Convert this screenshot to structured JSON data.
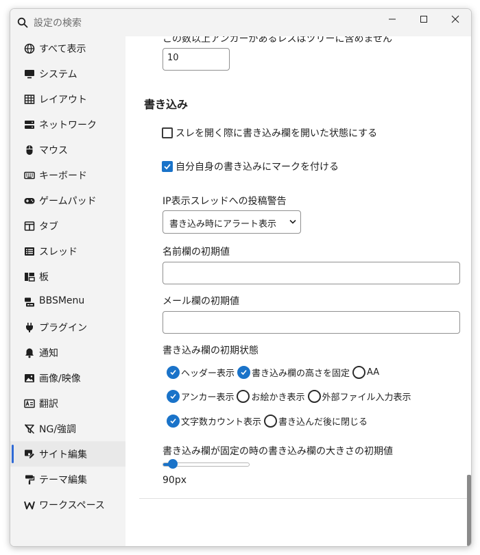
{
  "search": {
    "placeholder": "設定の検索"
  },
  "window_controls": {
    "minimize": "minimize",
    "maximize": "maximize",
    "close": "close"
  },
  "sidebar": {
    "items": [
      {
        "label": "すべて表示",
        "icon": "globe-icon"
      },
      {
        "label": "システム",
        "icon": "monitor-icon"
      },
      {
        "label": "レイアウト",
        "icon": "grid-icon"
      },
      {
        "label": "ネットワーク",
        "icon": "server-icon"
      },
      {
        "label": "マウス",
        "icon": "mouse-icon"
      },
      {
        "label": "キーボード",
        "icon": "keyboard-icon"
      },
      {
        "label": "ゲームパッド",
        "icon": "gamepad-icon"
      },
      {
        "label": "タブ",
        "icon": "tab-icon"
      },
      {
        "label": "スレッド",
        "icon": "list-icon"
      },
      {
        "label": "板",
        "icon": "board-icon"
      },
      {
        "label": "BBSMenu",
        "icon": "bbsmenu-icon"
      },
      {
        "label": "プラグイン",
        "icon": "plug-icon"
      },
      {
        "label": "通知",
        "icon": "bell-icon"
      },
      {
        "label": "画像/映像",
        "icon": "image-icon"
      },
      {
        "label": "翻訳",
        "icon": "translate-icon"
      },
      {
        "label": "NG/強調",
        "icon": "filter-off-icon"
      },
      {
        "label": "サイト編集",
        "icon": "site-edit-icon",
        "active": true
      },
      {
        "label": "テーマ編集",
        "icon": "paint-roller-icon"
      },
      {
        "label": "ワークスペース",
        "icon": "workspace-icon"
      }
    ]
  },
  "main": {
    "anchor_limit_label": "この数以上アンカーがあるレスはツリーに含めません",
    "anchor_limit_value": "10",
    "section_title": "書き込み",
    "open_on_thread": {
      "label": "スレを開く際に書き込み欄を開いた状態にする",
      "checked": false
    },
    "mark_own_posts": {
      "label": "自分自身の書き込みにマークを付ける",
      "checked": true
    },
    "ip_warning": {
      "label": "IP表示スレッドへの投稿警告",
      "value": "書き込み時にアラート表示"
    },
    "name_default": {
      "label": "名前欄の初期値",
      "value": ""
    },
    "mail_default": {
      "label": "メール欄の初期値",
      "value": ""
    },
    "initial_state": {
      "label": "書き込み欄の初期状態",
      "options": [
        {
          "label": "ヘッダー表示",
          "checked": true
        },
        {
          "label": "書き込み欄の高さを固定",
          "checked": true
        },
        {
          "label": "AA",
          "checked": false
        },
        {
          "label": "アンカー表示",
          "checked": true
        },
        {
          "label": "お絵かき表示",
          "checked": false
        },
        {
          "label": "外部ファイル入力表示",
          "checked": false
        },
        {
          "label": "文字数カウント表示",
          "checked": true
        },
        {
          "label": "書き込んだ後に閉じる",
          "checked": false
        }
      ]
    },
    "fixed_size": {
      "label": "書き込み欄が固定の時の書き込み欄の大きさの初期値",
      "value_text": "90px",
      "fraction": 0.12
    }
  },
  "colors": {
    "accent": "#1a73c9",
    "sidebar_bg": "#f3f3f3",
    "active_indicator": "#2f6ad6"
  }
}
